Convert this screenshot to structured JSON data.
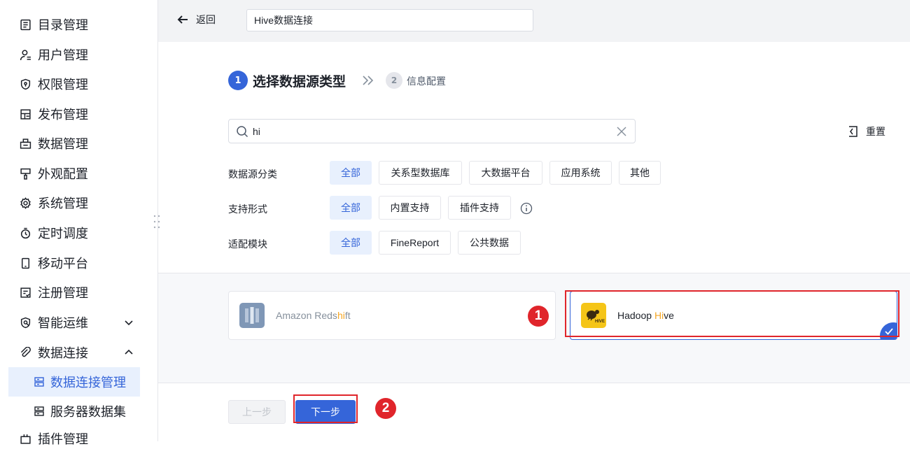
{
  "sidebar": {
    "items": [
      {
        "label": "目录管理",
        "icon": "catalog-icon"
      },
      {
        "label": "用户管理",
        "icon": "user-icon"
      },
      {
        "label": "权限管理",
        "icon": "shield-icon"
      },
      {
        "label": "发布管理",
        "icon": "publish-icon"
      },
      {
        "label": "数据管理",
        "icon": "data-icon"
      },
      {
        "label": "外观配置",
        "icon": "brush-icon"
      },
      {
        "label": "系统管理",
        "icon": "gear-icon"
      },
      {
        "label": "定时调度",
        "icon": "timer-icon"
      },
      {
        "label": "移动平台",
        "icon": "mobile-icon"
      },
      {
        "label": "注册管理",
        "icon": "register-icon"
      },
      {
        "label": "智能运维",
        "icon": "ops-icon"
      },
      {
        "label": "数据连接",
        "icon": "link-icon"
      },
      {
        "label": "插件管理",
        "icon": "plugin-icon"
      }
    ],
    "sub_items": [
      {
        "label": "数据连接管理",
        "icon": "connection-icon",
        "active": true
      },
      {
        "label": "服务器数据集",
        "icon": "dataset-icon",
        "active": false
      }
    ]
  },
  "topbar": {
    "back_label": "返回",
    "connection_name": "Hive数据连接"
  },
  "steps": {
    "step1_num": "1",
    "step1_label": "选择数据源类型",
    "step2_num": "2",
    "step2_label": "信息配置"
  },
  "search": {
    "value": "hi",
    "reset_label": "重置"
  },
  "filters": {
    "category": {
      "label": "数据源分类",
      "options": [
        "全部",
        "关系型数据库",
        "大数据平台",
        "应用系统",
        "其他"
      ],
      "selected": "全部"
    },
    "support": {
      "label": "支持形式",
      "options": [
        "全部",
        "内置支持",
        "插件支持"
      ],
      "selected": "全部"
    },
    "module": {
      "label": "适配模块",
      "options": [
        "全部",
        "FineReport",
        "公共数据"
      ],
      "selected": "全部"
    }
  },
  "results": [
    {
      "prefix": "Amazon Reds",
      "match": "hi",
      "suffix": "ft",
      "selected": false
    },
    {
      "prefix": "Hadoop ",
      "match": "Hi",
      "suffix": "ve",
      "selected": true
    }
  ],
  "annotations": {
    "badge1": "1",
    "badge2": "2"
  },
  "footer": {
    "prev_label": "上一步",
    "next_label": "下一步"
  },
  "colors": {
    "accent": "#3565d9",
    "highlight": "#f5a623",
    "annotation_red": "#e0252b"
  }
}
